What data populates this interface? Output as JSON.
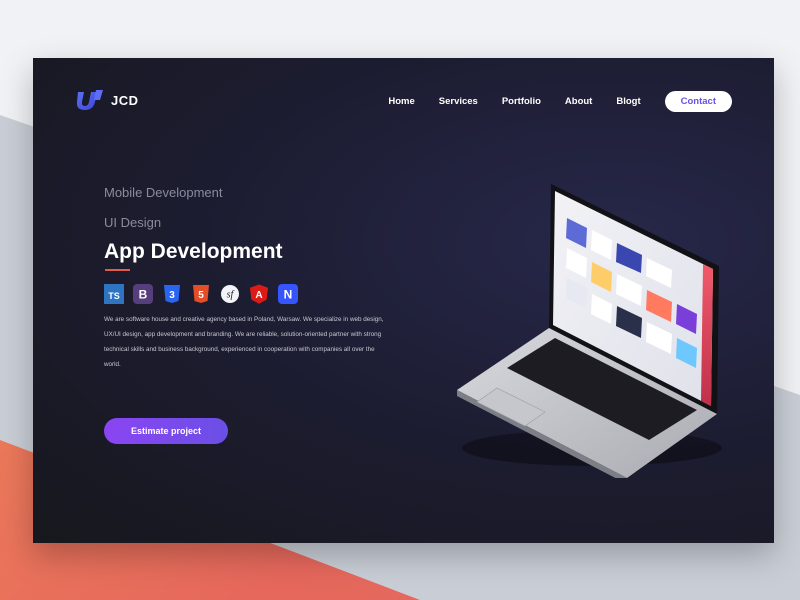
{
  "brand": {
    "name": "JCD",
    "accent": "#6b4fe6"
  },
  "nav": {
    "items": [
      "Home",
      "Services",
      "Portfolio",
      "About",
      "Blogt"
    ],
    "contact_label": "Contact"
  },
  "hero": {
    "line1": "Mobile Development",
    "line2": "UI Design",
    "title": "App Development",
    "tech_icons": [
      "typescript-icon",
      "bootstrap-icon",
      "css3-icon",
      "html5-icon",
      "symfony-icon",
      "angular-icon",
      "nativescript-icon"
    ],
    "tech_labels": {
      "ts": "TS",
      "bs": "B",
      "css": "3",
      "html": "5",
      "sf": "sf",
      "ng": "A",
      "ns": "N"
    },
    "description": "We are software house and creative agency based in Poland, Warsaw. We specialize in web design, UX/UI design, app development and branding. We are reliable, solution-oriented partner with strong technical skills and business background, experienced in cooperation with companies all over the world.",
    "cta_label": "Estimate project"
  }
}
